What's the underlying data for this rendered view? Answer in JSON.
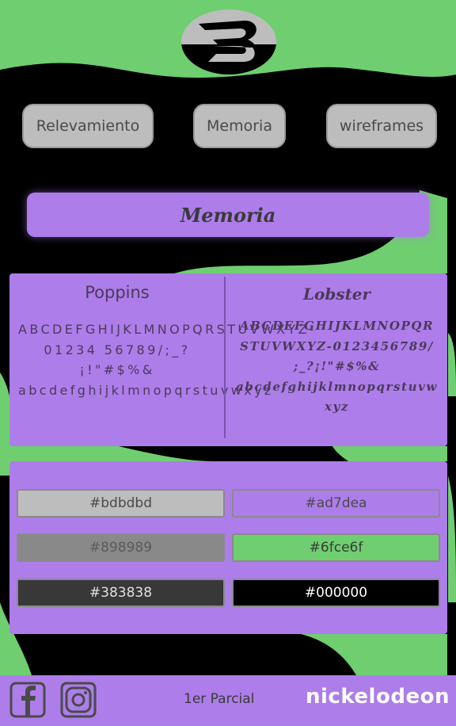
{
  "nav": {
    "buttons": [
      {
        "label": "Relevamiento"
      },
      {
        "label": "Memoria"
      },
      {
        "label": "wireframes"
      }
    ]
  },
  "section": {
    "title": "Memoria"
  },
  "fonts": {
    "primary": {
      "name": "Poppins",
      "sample": "ABCDEFGHIJKLMNOPQRSTUVWXYZ-01234 56789/;_?¡!\"#$%& abcdefghijklmnopqrstuvwxyz"
    },
    "secondary": {
      "name": "Lobster",
      "sample": "ABCDEFGHIJKLMNOPQR STUVWXYZ-0123456789/ ;_?¡!\"#$%& abcdefghijklmnopqrstuvw xyz"
    }
  },
  "palette": {
    "swatches": [
      {
        "hex": "#bdbdbd",
        "color": "#bdbdbd",
        "text_color": "#4a4a4a"
      },
      {
        "hex": "#ad7dea",
        "color": "#ad7dea",
        "text_color": "#4a4a4a"
      },
      {
        "hex": "#898989",
        "color": "#898989",
        "text_color": "#5a5a5a"
      },
      {
        "hex": "#6fce6f",
        "color": "#6fce6f",
        "text_color": "#3a3a3a"
      },
      {
        "hex": "#383838",
        "color": "#383838",
        "text_color": "#e0e0e0"
      },
      {
        "hex": "#000000",
        "color": "#000000",
        "text_color": "#ffffff"
      }
    ]
  },
  "footer": {
    "text": "1er Parcial",
    "brand": "nickelodeon",
    "icons": [
      "facebook-icon",
      "instagram-icon"
    ]
  },
  "colors": {
    "background": "#000000",
    "accent_green": "#6fce6f",
    "accent_purple": "#ad7dea",
    "button_gray": "#bdbdbd"
  }
}
